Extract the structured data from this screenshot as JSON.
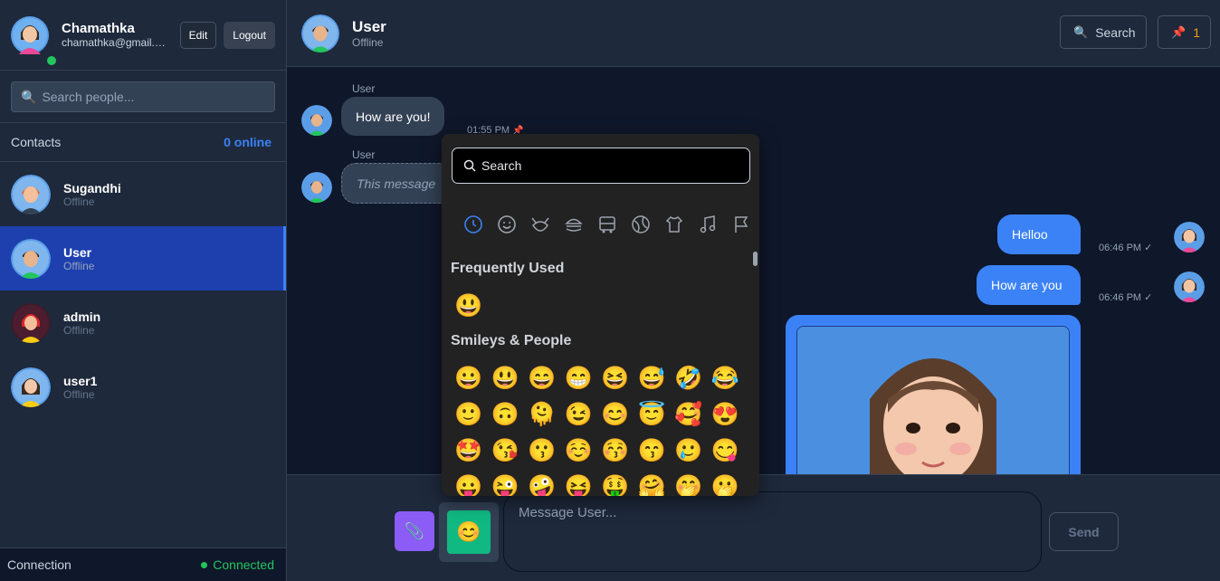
{
  "profile": {
    "name": "Chamathka",
    "email": "chamathka@gmail.com",
    "edit_label": "Edit",
    "logout_label": "Logout"
  },
  "sidebar": {
    "search_placeholder": "Search people...",
    "contacts_label": "Contacts",
    "online_count": "0 online",
    "contacts": [
      {
        "name": "Sugandhi",
        "status": "Offline"
      },
      {
        "name": "User",
        "status": "Offline"
      },
      {
        "name": "admin",
        "status": "Offline"
      },
      {
        "name": "user1",
        "status": "Offline"
      }
    ],
    "connection_label": "Connection",
    "connection_status": "Connected"
  },
  "chat": {
    "name": "User",
    "status": "Offline",
    "search_label": "Search",
    "pin_count": "1"
  },
  "messages": {
    "m1": {
      "sender": "User",
      "text": "How are you!",
      "time": "01:55 PM"
    },
    "m2": {
      "sender": "User",
      "text": "This message"
    },
    "m3": {
      "text": "Helloo",
      "time": "06:46 PM ✓"
    },
    "m4": {
      "text": "How are you",
      "time": "06:46 PM ✓"
    }
  },
  "composer": {
    "placeholder": "Message User...",
    "send_label": "Send"
  },
  "emoji_picker": {
    "search_placeholder": "Search",
    "categories": [
      "recent",
      "smileys",
      "animals",
      "food",
      "travel",
      "activities",
      "objects",
      "symbols",
      "flags"
    ],
    "frequently_used_title": "Frequently Used",
    "frequently_used": [
      "😃"
    ],
    "smileys_title": "Smileys & People",
    "smileys": [
      "😀",
      "😃",
      "😄",
      "😁",
      "😆",
      "😅",
      "🤣",
      "😂",
      "🙂",
      "🙃",
      "🫠",
      "😉",
      "😊",
      "😇",
      "🥰",
      "😍",
      "🤩",
      "😘",
      "😗",
      "☺️",
      "😚",
      "😙",
      "🥲",
      "😋",
      "😛",
      "😜",
      "🤪",
      "😝",
      "🤑",
      "🤗",
      "🤭",
      "🫢"
    ]
  },
  "colors": {
    "accent": "#3b82f6",
    "active_contact": "#1e40af",
    "online": "#22c55e",
    "emoji_button": "#10b981",
    "attach_button": "#8b5cf6"
  }
}
